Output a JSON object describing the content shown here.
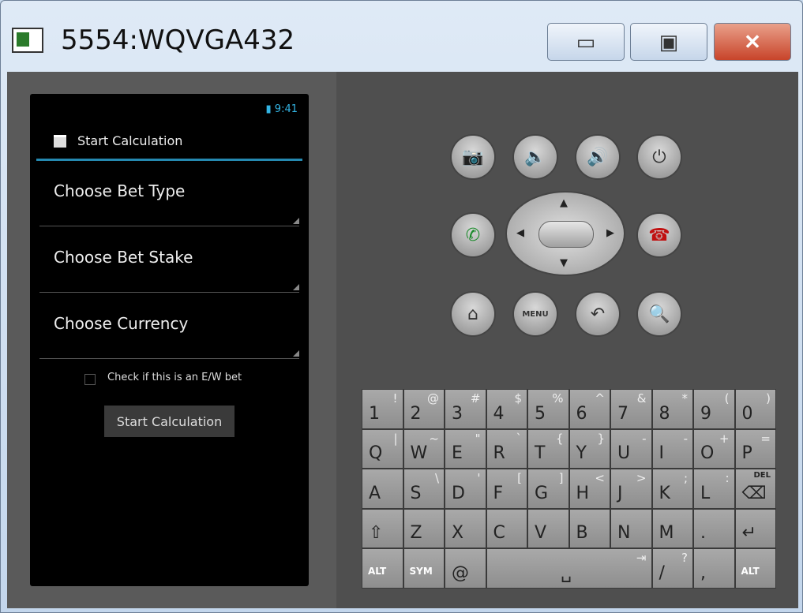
{
  "window": {
    "title": "5554:WQVGA432",
    "minimize": "▭",
    "maximize": "▣",
    "close": "✕"
  },
  "phone": {
    "status_time": "9:41",
    "action_bar_title": "Start Calculation",
    "spinners": [
      "Choose Bet Type",
      "Choose Bet Stake",
      "Choose Currency"
    ],
    "checkbox_label": "Check if this is an E/W bet",
    "button": "Start Calculation"
  },
  "controls": {
    "row1": [
      "📷",
      "🔈",
      "🔊",
      "⏻"
    ],
    "call": "✆",
    "end_call": "☎",
    "row3": [
      "⌂",
      "MENU",
      "↶",
      "🔍"
    ],
    "dpad": [
      "▲",
      "▼",
      "◀",
      "▶"
    ]
  },
  "keyboard": [
    [
      [
        "1",
        "!"
      ],
      [
        "2",
        "@"
      ],
      [
        "3",
        "#"
      ],
      [
        "4",
        "$"
      ],
      [
        "5",
        "%"
      ],
      [
        "6",
        "^"
      ],
      [
        "7",
        "&"
      ],
      [
        "8",
        "*"
      ],
      [
        "9",
        "("
      ],
      [
        "0",
        ")"
      ]
    ],
    [
      [
        "Q",
        "|"
      ],
      [
        "W",
        "~"
      ],
      [
        "E",
        "\""
      ],
      [
        "R",
        "`"
      ],
      [
        "T",
        "{"
      ],
      [
        "Y",
        "}"
      ],
      [
        "U",
        "-"
      ],
      [
        "I",
        "-"
      ],
      [
        "O",
        "+"
      ],
      [
        "P",
        "="
      ]
    ],
    [
      [
        "A",
        ""
      ],
      [
        "S",
        "\\"
      ],
      [
        "D",
        "'"
      ],
      [
        "F",
        "["
      ],
      [
        "G",
        "]"
      ],
      [
        "H",
        "<"
      ],
      [
        "J",
        ">"
      ],
      [
        "K",
        ";"
      ],
      [
        "L",
        ":"
      ],
      [
        "⌫",
        "DEL"
      ]
    ],
    [
      [
        "⇧",
        ""
      ],
      [
        "Z",
        ""
      ],
      [
        "X",
        ""
      ],
      [
        "C",
        ""
      ],
      [
        "V",
        ""
      ],
      [
        "B",
        ""
      ],
      [
        "N",
        ""
      ],
      [
        "M",
        ""
      ],
      [
        ".",
        ""
      ],
      [
        "↵",
        ""
      ]
    ],
    [
      [
        "ALT",
        ""
      ],
      [
        "SYM",
        ""
      ],
      [
        "@",
        ""
      ],
      [
        "␣",
        "⇥"
      ],
      [
        "/",
        "?"
      ],
      [
        ",",
        ""
      ],
      [
        "ALT",
        ""
      ]
    ]
  ]
}
